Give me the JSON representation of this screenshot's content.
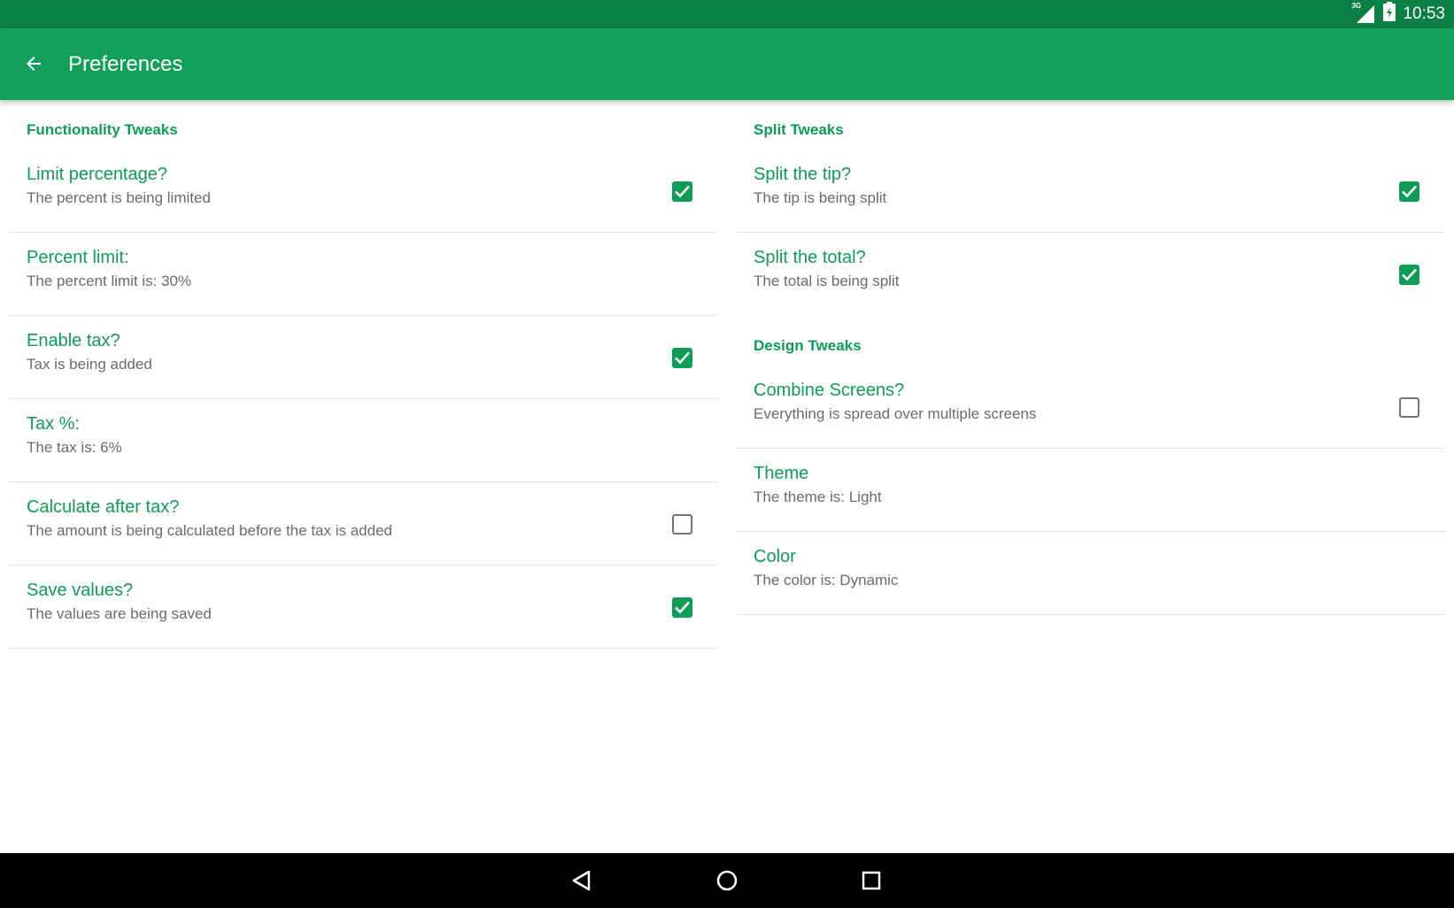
{
  "status_bar": {
    "network_label": "3G",
    "time": "10:53",
    "icons": [
      "signal-icon",
      "battery-icon"
    ]
  },
  "app_bar": {
    "title": "Preferences",
    "back_icon": "arrow-back-icon",
    "color": "#13a05a"
  },
  "colors": {
    "accent": "#0d9d57",
    "status_bar": "#0b8043",
    "summary_text": "#6b6b6b"
  },
  "left_column": {
    "sections": [
      {
        "header": "Functionality Tweaks",
        "items": [
          {
            "title": "Limit percentage?",
            "summary": "The percent is being limited",
            "checkbox": true,
            "checked": true
          },
          {
            "title": "Percent limit:",
            "summary": "The percent limit is: 30%",
            "checkbox": false
          },
          {
            "title": "Enable tax?",
            "summary": "Tax is being added",
            "checkbox": true,
            "checked": true
          },
          {
            "title": "Tax %:",
            "summary": "The tax is: 6%",
            "checkbox": false
          },
          {
            "title": "Calculate after tax?",
            "summary": "The amount is being calculated before the tax is added",
            "checkbox": true,
            "checked": false
          },
          {
            "title": "Save values?",
            "summary": "The values are being saved",
            "checkbox": true,
            "checked": true
          }
        ]
      }
    ]
  },
  "right_column": {
    "sections": [
      {
        "header": "Split Tweaks",
        "items": [
          {
            "title": "Split the tip?",
            "summary": "The tip is being split",
            "checkbox": true,
            "checked": true
          },
          {
            "title": "Split the total?",
            "summary": "The total is being split",
            "checkbox": true,
            "checked": true
          }
        ]
      },
      {
        "header": "Design Tweaks",
        "items": [
          {
            "title": "Combine Screens?",
            "summary": "Everything is spread over multiple screens",
            "checkbox": true,
            "checked": false
          },
          {
            "title": "Theme",
            "summary": "The theme is: Light",
            "checkbox": false
          },
          {
            "title": "Color",
            "summary": "The color is: Dynamic",
            "checkbox": false
          }
        ]
      }
    ]
  },
  "nav_bar": {
    "buttons": [
      "back-triangle-icon",
      "home-circle-icon",
      "recents-square-icon"
    ]
  }
}
